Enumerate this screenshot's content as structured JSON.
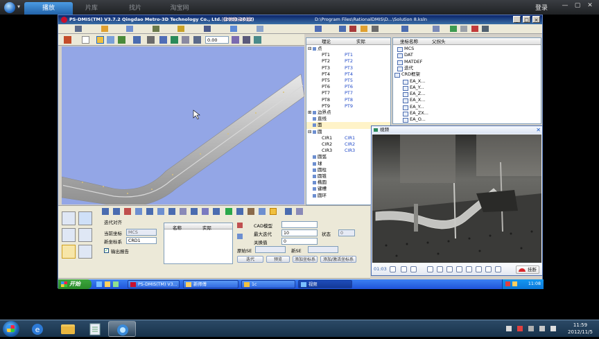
{
  "outer": {
    "tabs": [
      "播放",
      "片库",
      "找片",
      "淘宝网"
    ],
    "login": "登录",
    "win_controls": [
      "—",
      "▢",
      "✕"
    ]
  },
  "app": {
    "title": "PS-DMIS(TM) V3.7.2   Qingdao Metro-3D Technology Co., Ltd. (2003-2012)",
    "title_extra": "[非销售演示版]",
    "title_path": "D:\\Program Files\\RationalDMIS\\D...\\Solution 8.ksln",
    "zoom_value": "0.00"
  },
  "theory": {
    "headers": [
      "理论",
      "实际"
    ],
    "rows": [
      {
        "tree": "⊟",
        "label": "点",
        "actual": ""
      },
      {
        "tree": "",
        "label": "PT1",
        "actual": "PT1"
      },
      {
        "tree": "",
        "label": "PT2",
        "actual": "PT2"
      },
      {
        "tree": "",
        "label": "PT3",
        "actual": "PT3"
      },
      {
        "tree": "",
        "label": "PT4",
        "actual": "PT4"
      },
      {
        "tree": "",
        "label": "PT5",
        "actual": "PT5"
      },
      {
        "tree": "",
        "label": "PT6",
        "actual": "PT6"
      },
      {
        "tree": "",
        "label": "PT7",
        "actual": "PT7"
      },
      {
        "tree": "",
        "label": "PT8",
        "actual": "PT8"
      },
      {
        "tree": "",
        "label": "PT9",
        "actual": "PT9"
      },
      {
        "tree": "⊞",
        "label": "边界点",
        "actual": ""
      },
      {
        "tree": "",
        "label": "直线",
        "actual": ""
      },
      {
        "tree": "",
        "label": "面",
        "actual": ""
      },
      {
        "tree": "⊟",
        "label": "圆",
        "actual": ""
      },
      {
        "tree": "",
        "label": "CIR1",
        "actual": "CIR1"
      },
      {
        "tree": "",
        "label": "CIR2",
        "actual": "CIR2"
      },
      {
        "tree": "",
        "label": "CIR3",
        "actual": "CIR3"
      },
      {
        "tree": "",
        "label": "圆弧",
        "actual": ""
      },
      {
        "tree": "",
        "label": "球",
        "actual": ""
      },
      {
        "tree": "",
        "label": "圆柱",
        "actual": ""
      },
      {
        "tree": "",
        "label": "圆锥",
        "actual": ""
      },
      {
        "tree": "",
        "label": "椭圆",
        "actual": ""
      },
      {
        "tree": "",
        "label": "键槽",
        "actual": ""
      },
      {
        "tree": "",
        "label": "圆环",
        "actual": ""
      }
    ]
  },
  "coord": {
    "headers": [
      "坐标名称",
      "父拐头"
    ],
    "rows": [
      "MCS",
      "DAT",
      "MATDEF",
      "迭代",
      "CRD框架",
      "EA_X...",
      "EA_Y...",
      "EA_Z...",
      "EA_X...",
      "EA_Y...",
      "EA_ZX...",
      "EA_O..."
    ]
  },
  "align": {
    "title": "迭代对齐",
    "current_label": "当前坐标",
    "current_value": "MCS",
    "new_label": "新坐标系",
    "new_value": "CRD1",
    "output_label": "输出报告",
    "grid_headers": [
      "名称",
      "实际"
    ],
    "cad_label": "CAD模型",
    "max_iter_label": "最大迭代",
    "max_iter_value": "10",
    "state_label": "状态",
    "state_value": "0",
    "tol_label": "关换值",
    "tol_value": "0",
    "orig_label": "原始SE",
    "new_se_label": "新SE",
    "buttons": [
      "迭代",
      "预览",
      "添加坐标系",
      "添加/激活坐标系"
    ]
  },
  "status_tab": "标准",
  "xp_taskbar": {
    "start": "开始",
    "buttons": [
      "PS-DMIS(TM) V3...",
      "新师傅",
      "1c",
      "视频"
    ],
    "clock": "11:08"
  },
  "video": {
    "title": "视频",
    "time": "01:03",
    "hangup": "挂断"
  },
  "win7_taskbar": {
    "time": "11:59",
    "date": "2012/11/5"
  }
}
